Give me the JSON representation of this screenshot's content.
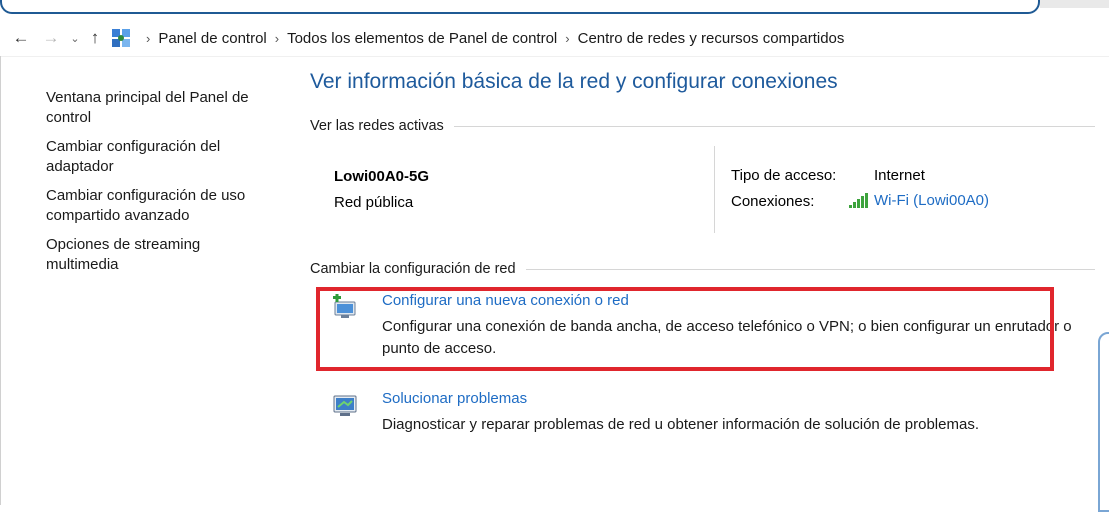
{
  "breadcrumb": {
    "items": [
      "Panel de control",
      "Todos los elementos de Panel de control",
      "Centro de redes y recursos compartidos"
    ],
    "separator": "›"
  },
  "nav": {
    "back_icon": "back-arrow-icon",
    "forward_icon": "forward-arrow-icon",
    "recent_icon": "chevron-down-icon",
    "up_icon": "up-arrow-icon"
  },
  "sidebar": {
    "items": [
      "Ventana principal del Panel de control",
      "Cambiar configuración del adaptador",
      "Cambiar configuración de uso compartido avanzado",
      "Opciones de streaming multimedia"
    ]
  },
  "main": {
    "title": "Ver información básica de la red y configurar conexiones",
    "active_networks_heading": "Ver las redes activas",
    "network": {
      "name": "Lowi00A0-5G",
      "type": "Red pública",
      "access_label": "Tipo de acceso:",
      "access_value": "Internet",
      "connections_label": "Conexiones:",
      "connections_value": "Wi-Fi (Lowi00A0)"
    },
    "change_heading": "Cambiar la configuración de red",
    "tasks": [
      {
        "link": "Configurar una nueva conexión o red",
        "desc": "Configurar una conexión de banda ancha, de acceso telefónico o VPN; o bien configurar un enrutador o punto de acceso.",
        "icon": "new-connection-icon"
      },
      {
        "link": "Solucionar problemas",
        "desc": "Diagnosticar y reparar problemas de red u obtener información de solución de problemas.",
        "icon": "troubleshoot-icon"
      }
    ]
  },
  "colors": {
    "link": "#1e6cc4",
    "title": "#1e5a9c",
    "highlight": "#e0262d"
  }
}
